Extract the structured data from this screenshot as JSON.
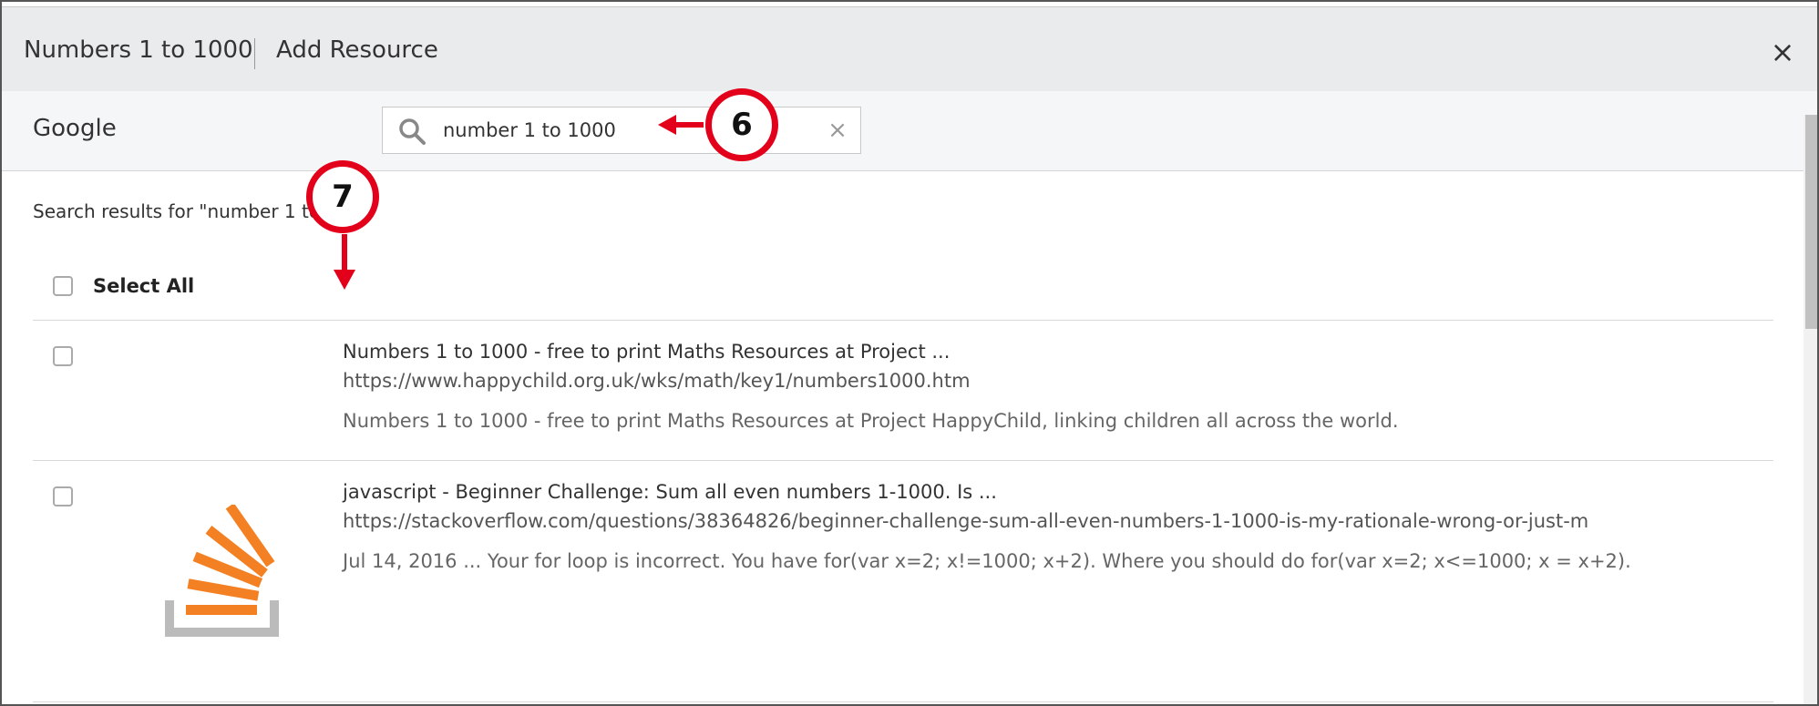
{
  "header": {
    "title": "Numbers 1 to 1000",
    "subtitle": "Add Resource",
    "close_symbol": "×"
  },
  "search": {
    "provider": "Google",
    "query": "number 1 to 1000",
    "clear_symbol": "×"
  },
  "results": {
    "heading": "Search results for \"number 1 to",
    "select_all_label": "Select All",
    "items": [
      {
        "title": "Numbers 1 to 1000 - free to print Maths Resources at Project ...",
        "url": "https://www.happychild.org.uk/wks/math/key1/numbers1000.htm",
        "snippet": "Numbers 1 to 1000 - free to print Maths Resources at Project HappyChild, linking children all across the world.",
        "thumbnail_icon": ""
      },
      {
        "title": "javascript - Beginner Challenge: Sum all even numbers 1-1000. Is ...",
        "url": "https://stackoverflow.com/questions/38364826/beginner-challenge-sum-all-even-numbers-1-1000-is-my-rationale-wrong-or-just-m",
        "snippet": "Jul 14, 2016 ... Your for loop is incorrect. You have for(var x=2; x!=1000; x+2). Where you should do for(var x=2; x<=1000; x = x+2).",
        "thumbnail_icon": "stackoverflow-logo-icon"
      }
    ]
  },
  "annotations": {
    "callout_6": "6",
    "callout_7": "7",
    "color": "#e3001b"
  },
  "colors": {
    "header_bg": "#e9ebed",
    "searchbar_bg": "#f5f6f7",
    "stackoverflow_orange": "#f48024",
    "stackoverflow_gray": "#bcbbbb"
  }
}
